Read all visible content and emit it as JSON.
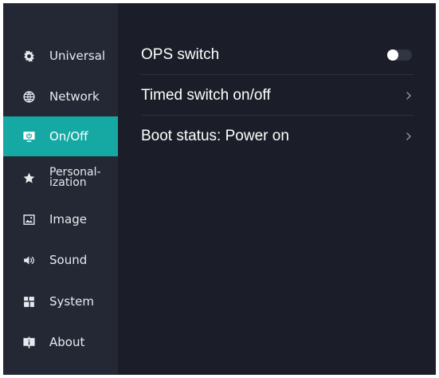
{
  "colors": {
    "frame_bg": "#ffffff",
    "screen_bg": "#1b1e28",
    "sidebar_bg": "#242835",
    "accent": "#16a9a4",
    "text_primary": "#ffffff",
    "text_secondary": "#e7e9ee",
    "divider": "#2d3240",
    "chevron": "#8b90a0"
  },
  "sidebar": {
    "items": [
      {
        "label": "Universal",
        "icon": "gear-icon"
      },
      {
        "label": "Network",
        "icon": "globe-icon"
      },
      {
        "label": "On/Off",
        "icon": "monitor-power-icon",
        "active": true
      },
      {
        "label": "Personal-\nization",
        "icon": "star-icon"
      },
      {
        "label": "Image",
        "icon": "image-icon"
      },
      {
        "label": "Sound",
        "icon": "speaker-icon"
      },
      {
        "label": "System",
        "icon": "grid-icon"
      },
      {
        "label": "About",
        "icon": "info-board-icon"
      }
    ]
  },
  "settings": {
    "ops_switch": {
      "label": "OPS switch",
      "toggle_on": false
    },
    "timed_switch": {
      "label": "Timed switch on/off",
      "icon": "chevron-right-icon"
    },
    "boot_status": {
      "label": "Boot status:  Power on",
      "icon": "chevron-right-icon"
    }
  }
}
